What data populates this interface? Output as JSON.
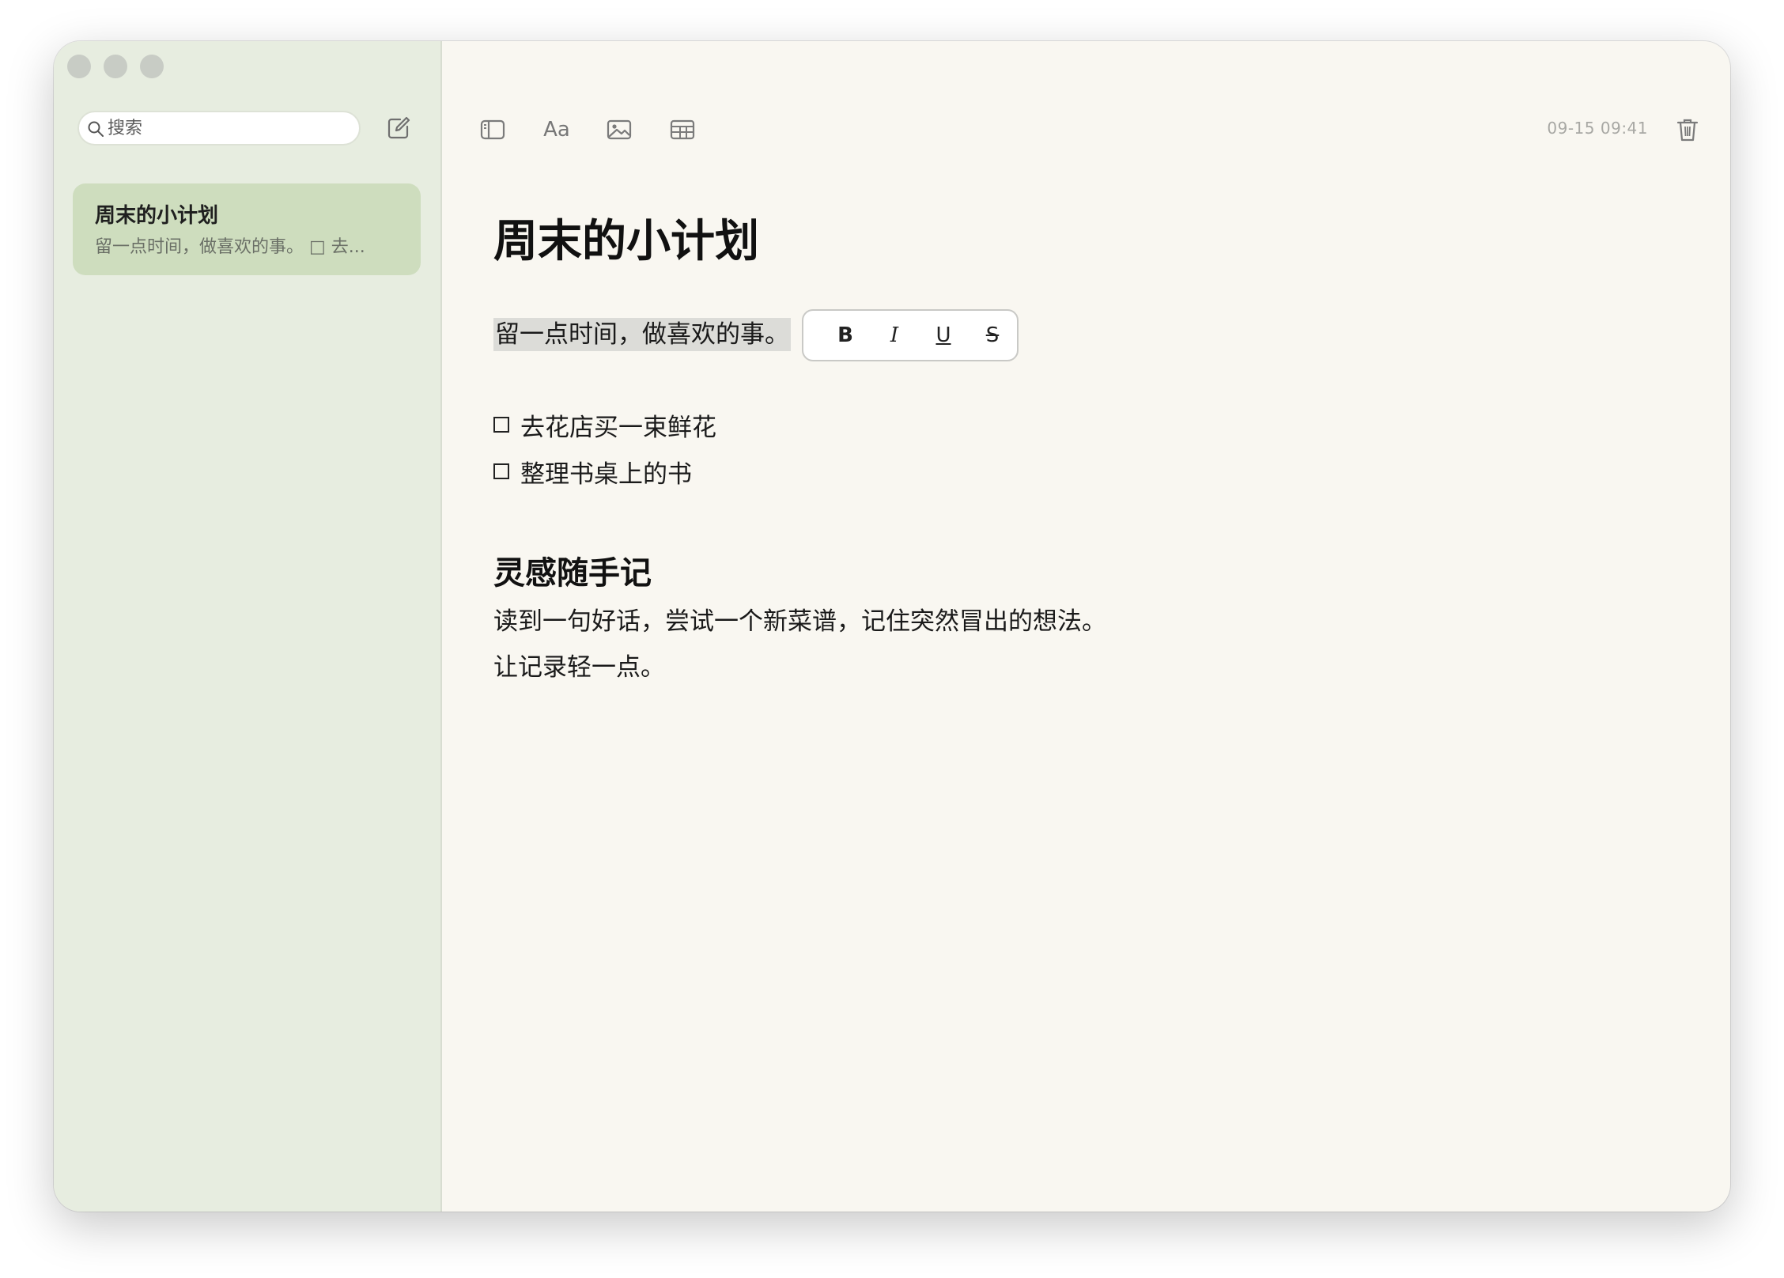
{
  "sidebar": {
    "search": {
      "placeholder": "搜索",
      "value": ""
    },
    "notes": [
      {
        "title": "周末的小计划",
        "preview": "留一点时间，做喜欢的事。 □ 去..."
      }
    ]
  },
  "toolbar": {
    "format_label": "Aa",
    "timestamp": "09-15 09:41",
    "icons": [
      "sidebar-toggle-icon",
      "format-icon",
      "image-icon",
      "table-icon",
      "trash-icon"
    ]
  },
  "document": {
    "title": "周末的小计划",
    "selected_line": "留一点时间，做喜欢的事。",
    "format_popup": {
      "bold": "B",
      "italic": "I",
      "underline": "U",
      "strike": "S"
    },
    "todos": [
      "去花店买一束鲜花",
      "整理书桌上的书"
    ],
    "section_heading": "灵感随手记",
    "body_lines": [
      "读到一句好话，尝试一个新菜谱，记住突然冒出的想法。",
      "让记录轻一点。"
    ]
  },
  "colors": {
    "sidebar_bg": "#e7ede0",
    "selected_note_bg": "#ceddbe",
    "editor_bg": "#f9f7f1"
  }
}
